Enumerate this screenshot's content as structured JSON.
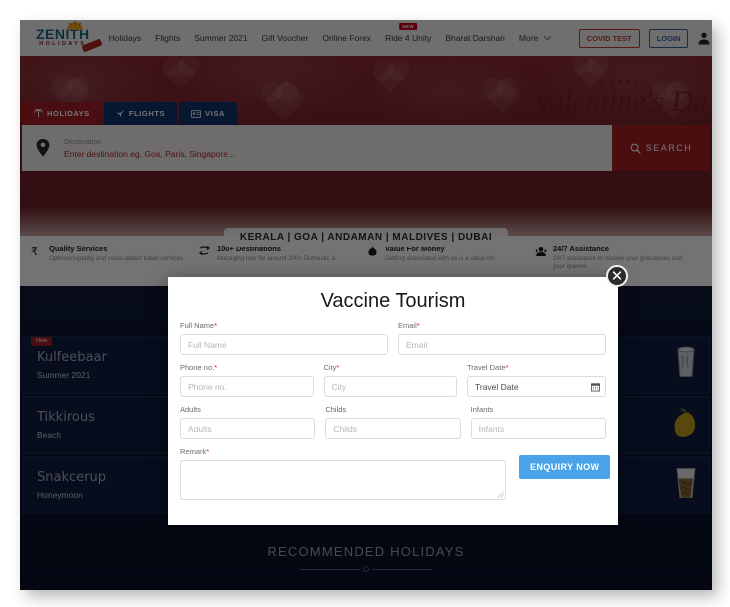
{
  "header": {
    "logo": {
      "primary": "ZENITH",
      "secondary": "HOLIDAYS"
    },
    "nav": [
      {
        "label": "Holidays",
        "badge": ""
      },
      {
        "label": "Flights",
        "badge": ""
      },
      {
        "label": "Summer 2021",
        "badge": ""
      },
      {
        "label": "Gift Voucher",
        "badge": ""
      },
      {
        "label": "Online Forex",
        "badge": ""
      },
      {
        "label": "Ride 4 Unity",
        "badge": "NEW"
      },
      {
        "label": "Bharat Darshan",
        "badge": ""
      },
      {
        "label": "More",
        "badge": ""
      }
    ],
    "globe_icon": "globe-icon",
    "covid_button": "COVID TEST",
    "login_button": "LOGIN",
    "user_icon": "user-avatar-icon",
    "chevron_icon": "chevron-down-icon"
  },
  "hero": {
    "valentine_small": "HAPPY",
    "valentine_main": "Valentine's Da",
    "tabs": [
      {
        "label": "HOLIDAYS",
        "icon": "palm-tree-icon",
        "active": true
      },
      {
        "label": "FLIGHTS",
        "icon": "airplane-icon",
        "active": false
      },
      {
        "label": "VISA",
        "icon": "id-card-icon",
        "active": false
      }
    ],
    "search": {
      "pin_icon": "location-pin-icon",
      "label": "Destination",
      "placeholder": "Enter destination eg. Goa, Paris, Singapore...",
      "button_label": "SEARCH",
      "button_icon": "search-icon"
    },
    "destination_strip": "KERALA | GOA | ANDAMAN | MALDIVES | DUBAI"
  },
  "features": [
    {
      "icon": "rupee-icon",
      "title": "Quality Services",
      "desc": "Optimum-quality and value-added travel services"
    },
    {
      "icon": "destinations-icon",
      "title": "100+ Destinations",
      "desc": "Managing tour for around 100+ Domestic &"
    },
    {
      "icon": "money-bag-icon",
      "title": "Value For Money",
      "desc": "Getting associated with us is a value-for-"
    },
    {
      "icon": "support-agent-icon",
      "title": "24/7 Assistance",
      "desc": "24/7 assistance to resolve your grievances and your queries"
    }
  ],
  "promo_cards": [
    {
      "title": "Kulfeebaar",
      "subtitle": "Summer 2021",
      "badge": "New",
      "art": "drink-glass-icon"
    },
    {
      "title": "",
      "subtitle": "",
      "badge": "",
      "art": ""
    },
    {
      "title": "",
      "subtitle": "",
      "badge": "",
      "art": "drink-glass-icon"
    },
    {
      "title": "Tikkirous",
      "subtitle": "Beach",
      "badge": "",
      "art": "mango-icon"
    },
    {
      "title": "",
      "subtitle": "",
      "badge": "",
      "art": ""
    },
    {
      "title": "",
      "subtitle": "",
      "badge": "",
      "art": "mango-icon"
    },
    {
      "title": "Snakcerup",
      "subtitle": "Honeymoon",
      "badge": "",
      "art": "iced-drink-icon"
    },
    {
      "title": "",
      "subtitle": "",
      "badge": "",
      "art": ""
    },
    {
      "title": "",
      "subtitle": "",
      "badge": "",
      "art": "iced-drink-icon"
    }
  ],
  "recommended": {
    "title": "RECOMMENDED HOLIDAYS"
  },
  "modal": {
    "title": "Vaccine Tourism",
    "close_icon": "close-icon",
    "fields": {
      "full_name": {
        "label": "Full Name",
        "required": true,
        "placeholder": "Full Name",
        "value": ""
      },
      "email": {
        "label": "Email",
        "required": true,
        "placeholder": "Email",
        "value": ""
      },
      "phone": {
        "label": "Phone no.",
        "required": true,
        "placeholder": "Phone no.",
        "value": ""
      },
      "city": {
        "label": "City",
        "required": true,
        "placeholder": "City",
        "value": ""
      },
      "travel_date": {
        "label": "Travel Date",
        "required": true,
        "placeholder": "Travel Date",
        "value": "Travel Date",
        "icon": "calendar-icon"
      },
      "adults": {
        "label": "Adults",
        "required": false,
        "placeholder": "Adults",
        "value": ""
      },
      "childs": {
        "label": "Childs",
        "required": false,
        "placeholder": "Childs",
        "value": ""
      },
      "infants": {
        "label": "Infants",
        "required": false,
        "placeholder": "Infants",
        "value": ""
      },
      "remark": {
        "label": "Remark",
        "required": true,
        "placeholder": "",
        "value": ""
      }
    },
    "submit_label": "ENQUIRY NOW",
    "accent_color": "#4aa3e8",
    "required_color": "#e02020"
  }
}
